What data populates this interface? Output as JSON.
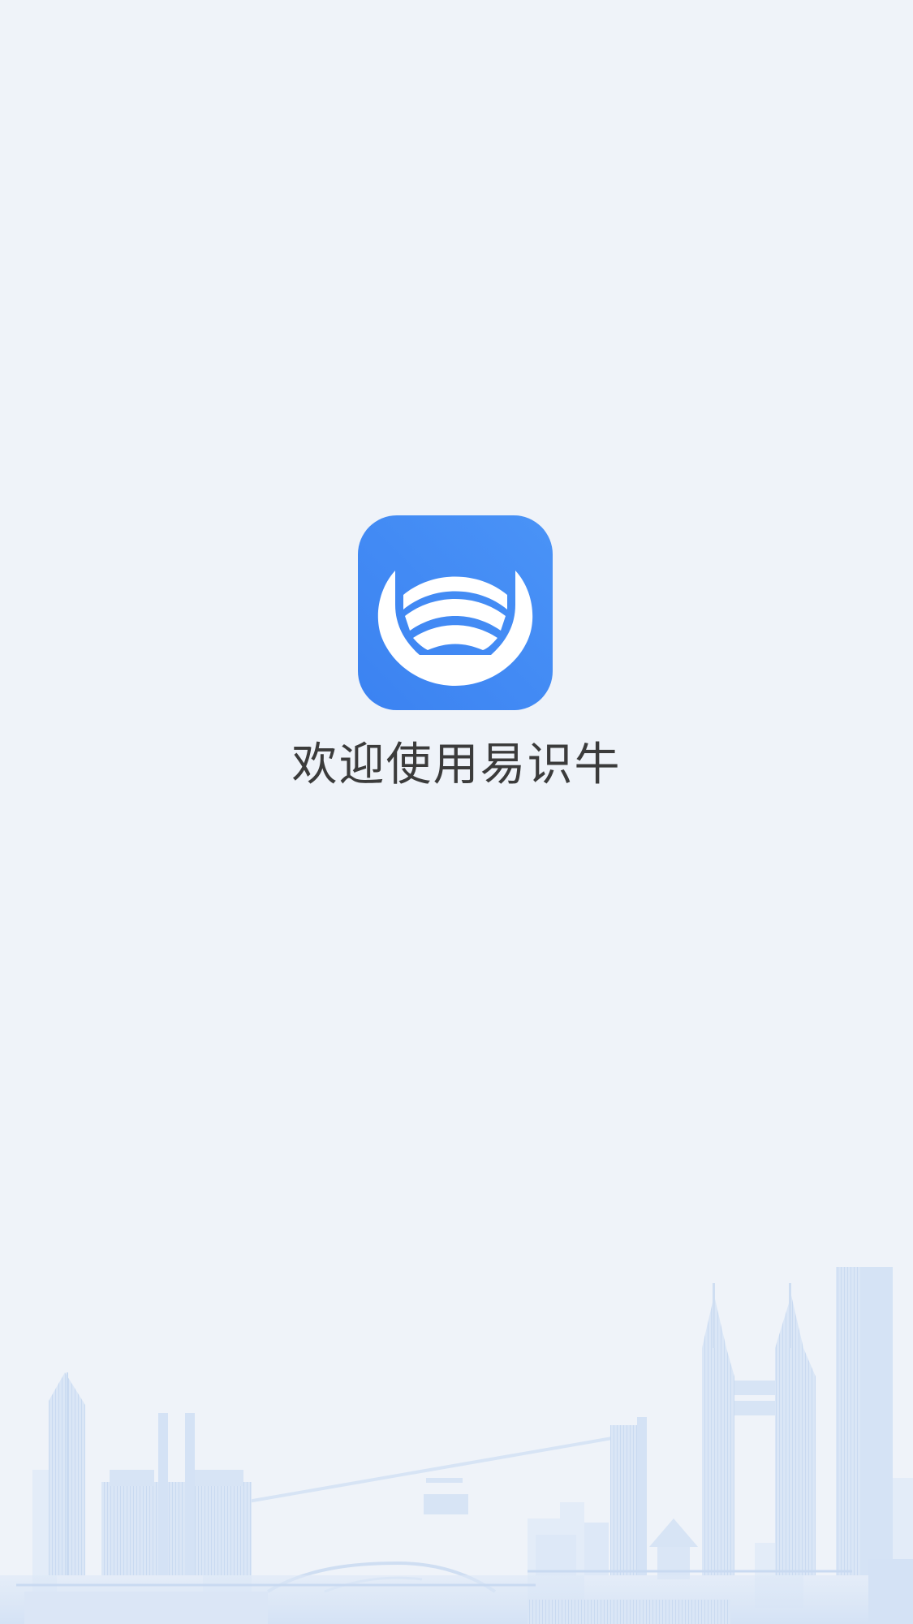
{
  "splash": {
    "welcome_text": "欢迎使用易识牛",
    "brand_color": "#3b82f1",
    "brand_color_light": "#4a93f7",
    "logo_icon": "app-logo-icon",
    "background_illustration": "city-skyline-illustration"
  }
}
